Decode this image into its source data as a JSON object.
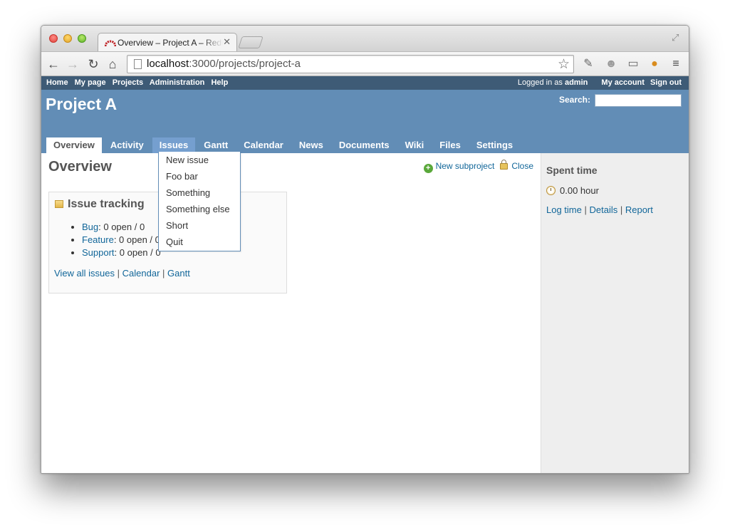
{
  "browser": {
    "tab_title": "Overview – Project A – Redmine",
    "tab_close": "✕",
    "url_host": "localhost",
    "url_rest": ":3000/projects/project-a"
  },
  "top_menu": {
    "left": [
      "Home",
      "My page",
      "Projects",
      "Administration",
      "Help"
    ],
    "logged_in_prefix": "Logged in as",
    "user": "admin",
    "my_account": "My account",
    "sign_out": "Sign out"
  },
  "header": {
    "project_title": "Project A",
    "search_label": "Search:",
    "search_value": ""
  },
  "main_menu": [
    {
      "label": "Overview",
      "state": "selected"
    },
    {
      "label": "Activity",
      "state": "normal"
    },
    {
      "label": "Issues",
      "state": "hover"
    },
    {
      "label": "Gantt",
      "state": "normal"
    },
    {
      "label": "Calendar",
      "state": "normal"
    },
    {
      "label": "News",
      "state": "normal"
    },
    {
      "label": "Documents",
      "state": "normal"
    },
    {
      "label": "Wiki",
      "state": "normal"
    },
    {
      "label": "Files",
      "state": "normal"
    },
    {
      "label": "Settings",
      "state": "normal"
    }
  ],
  "dropdown": [
    "New issue",
    "Foo bar",
    "Something",
    "Something else",
    "Short",
    "Quit"
  ],
  "content": {
    "title": "Overview",
    "new_subproject": "New subproject",
    "close": "Close"
  },
  "issue_box": {
    "title": "Issue tracking",
    "trackers": [
      {
        "name": "Bug",
        "stats": ": 0 open / 0"
      },
      {
        "name": "Feature",
        "stats": ": 0 open / 0"
      },
      {
        "name": "Support",
        "stats": ": 0 open / 0"
      }
    ],
    "view_all": "View all issues",
    "calendar": "Calendar",
    "gantt": "Gantt",
    "separator": " | "
  },
  "sidebar": {
    "title": "Spent time",
    "hours": "0.00 hour",
    "log_time": "Log time",
    "details": "Details",
    "report": "Report",
    "separator": " | "
  },
  "colors": {
    "top_menu": "#3e5b76",
    "header": "#628db6",
    "tab_hover": "#759fcf",
    "link": "#116699",
    "sidebar": "#eeeeee"
  }
}
